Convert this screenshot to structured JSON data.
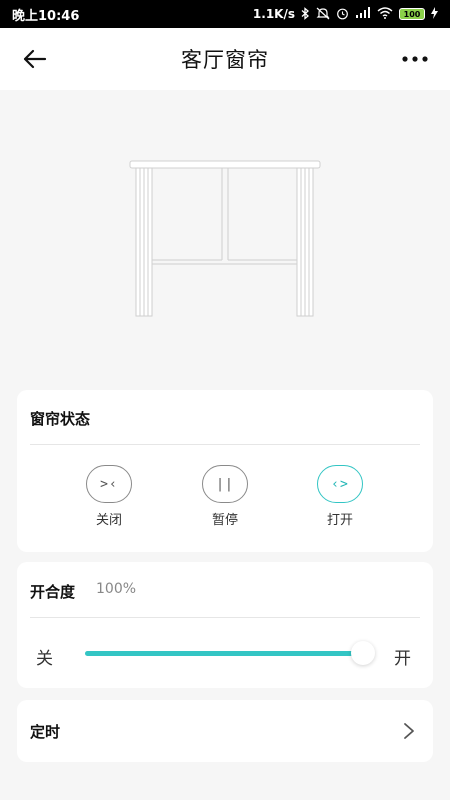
{
  "status_bar": {
    "time": "晚上10:46",
    "network_speed": "1.1K/s",
    "battery": "100"
  },
  "header": {
    "title": "客厅窗帘"
  },
  "status_card": {
    "title": "窗帘状态",
    "controls": [
      {
        "label": "关闭",
        "glyph": ">‹",
        "icon": "close-curtain-icon",
        "active": false
      },
      {
        "label": "暂停",
        "glyph": "||",
        "icon": "pause-icon",
        "active": false
      },
      {
        "label": "打开",
        "glyph": "‹>",
        "icon": "open-curtain-icon",
        "active": true
      }
    ]
  },
  "openness_card": {
    "title": "开合度",
    "value_text": "100%",
    "value": 100,
    "min_label": "关",
    "max_label": "开"
  },
  "timer_card": {
    "title": "定时"
  },
  "colors": {
    "accent": "#33c5c4",
    "background": "#f6f6f6",
    "card": "#ffffff"
  }
}
